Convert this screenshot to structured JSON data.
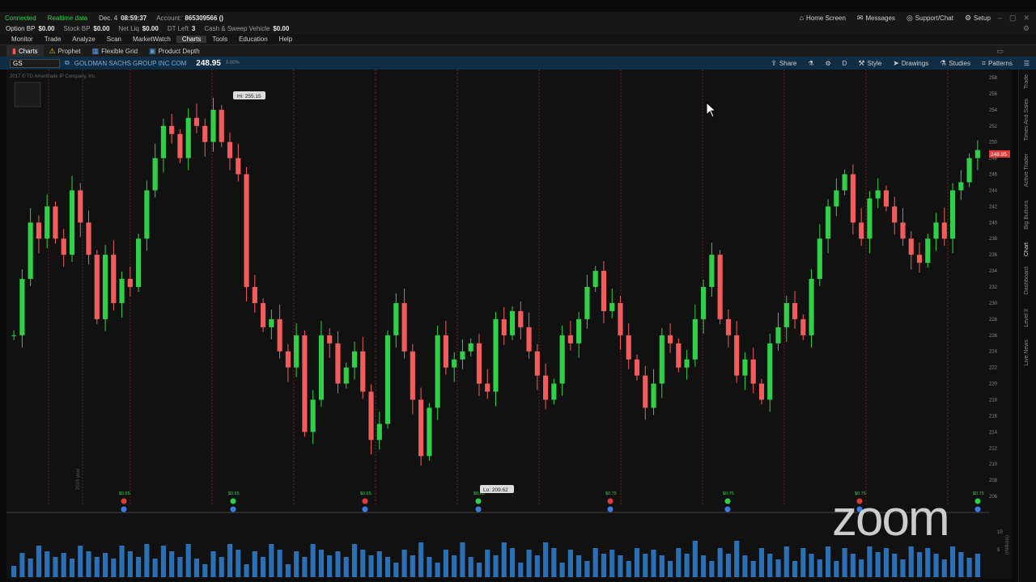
{
  "status": {
    "connected": "Connected",
    "realtime": "Realtime data",
    "date": "Dec. 4",
    "time": "08:59:37",
    "account_label": "Account:",
    "account_value": "865309566 ()"
  },
  "nav_right": {
    "home": "Home Screen",
    "messages": "Messages",
    "support": "Support/Chat",
    "setup": "Setup"
  },
  "balances": [
    {
      "label": "Option BP",
      "value": "$0.00"
    },
    {
      "label": "Stock BP",
      "value": "$0.00"
    },
    {
      "label": "Net Liq",
      "value": "$0.00"
    },
    {
      "label": "DT Left",
      "value": "3"
    },
    {
      "label": "Cash & Sweep Vehicle",
      "value": "$0.00"
    }
  ],
  "menu": [
    "Monitor",
    "Trade",
    "Analyze",
    "Scan",
    "MarketWatch",
    "Charts",
    "Tools",
    "Education",
    "Help"
  ],
  "subtabs": [
    "Charts",
    "Prophet",
    "Flexible Grid",
    "Product Depth"
  ],
  "symbol_bar": {
    "symbol": "GS",
    "company": "GOLDMAN SACHS GROUP INC COM",
    "price": "248.95",
    "change": "0.00%"
  },
  "toolbar": {
    "share": "Share",
    "timeframe": "D",
    "style": "Style",
    "drawings": "Drawings",
    "studies": "Studies",
    "patterns": "Patterns"
  },
  "chart_data": {
    "type": "candlestick",
    "symbol": "GS",
    "copyright": "2017 © TD Ameritrade IP Company, Inc.",
    "hi_label": "Hi: 255.15",
    "lo_label": "Lo: 209.62",
    "price_tag": "248.95",
    "ylim": [
      205,
      258
    ],
    "y_ticks": [
      "258",
      "256",
      "254",
      "252",
      "250",
      "248",
      "246",
      "244",
      "242",
      "240",
      "238",
      "236",
      "234",
      "232",
      "230",
      "228",
      "226",
      "224",
      "222",
      "220",
      "218",
      "216",
      "214",
      "212",
      "210",
      "208",
      "206"
    ],
    "volume_axis": [
      "10",
      "5"
    ],
    "volume_unit": "(millions)",
    "year_label": "2015 year",
    "closes": [
      226,
      233,
      240,
      238,
      242,
      238,
      236,
      244,
      240,
      236,
      228,
      236,
      230,
      233,
      232,
      238,
      244,
      248,
      252,
      251,
      248,
      253,
      252,
      250,
      254,
      250,
      248,
      246,
      232,
      230,
      227,
      228,
      224,
      222,
      226,
      214,
      218,
      226,
      225,
      220,
      222,
      224,
      219,
      213,
      215,
      226,
      230,
      224,
      218,
      211,
      217,
      226,
      222,
      223,
      224,
      225,
      220,
      219,
      228,
      226,
      229,
      227,
      224,
      221,
      218,
      220,
      226,
      225,
      228,
      232,
      234,
      229,
      230,
      226,
      223,
      221,
      217,
      220,
      226,
      225,
      222,
      223,
      228,
      232,
      236,
      228,
      226,
      221,
      223,
      220,
      218,
      225,
      227,
      230,
      228,
      226,
      233,
      238,
      242,
      244,
      246,
      240,
      238,
      243,
      244,
      242,
      240,
      238,
      236,
      235,
      238,
      240,
      238,
      244,
      245,
      248,
      249
    ],
    "dividends": [
      "$0.65",
      "$0.65",
      "$0.65",
      "$0.65",
      "$0.75",
      "$0.75",
      "$0.75",
      "$0.75"
    ]
  },
  "side_tabs": [
    "Trade",
    "Times And Sales",
    "Active Trader",
    "Big Buttons",
    "Chart",
    "Dashboard",
    "Level II",
    "Live News"
  ],
  "watermark": "zoom",
  "colors": {
    "up": "#2fcf47",
    "down": "#f25c5c",
    "grid_red": "#7a1c1c",
    "accent": "#0f2d45"
  }
}
